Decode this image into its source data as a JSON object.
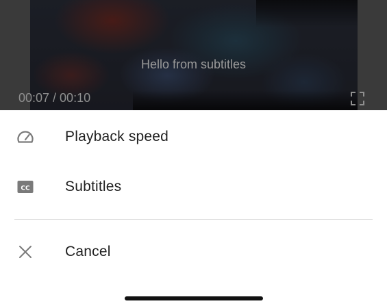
{
  "video": {
    "subtitle_text": "Hello from subtitles",
    "time_display": "00:07 / 00:10",
    "fullscreen_icon": "fullscreen-icon"
  },
  "menu": {
    "items": [
      {
        "label": "Playback speed",
        "icon": "speedometer-icon"
      },
      {
        "label": "Subtitles",
        "icon": "closed-captions-icon"
      }
    ],
    "cancel": {
      "label": "Cancel",
      "icon": "close-icon"
    }
  },
  "colors": {
    "sheet_background": "#ffffff",
    "label_text": "#1f1f1f",
    "icon_gray": "#7a7a7a",
    "divider": "#dcdcdc",
    "home_indicator": "#111111"
  }
}
